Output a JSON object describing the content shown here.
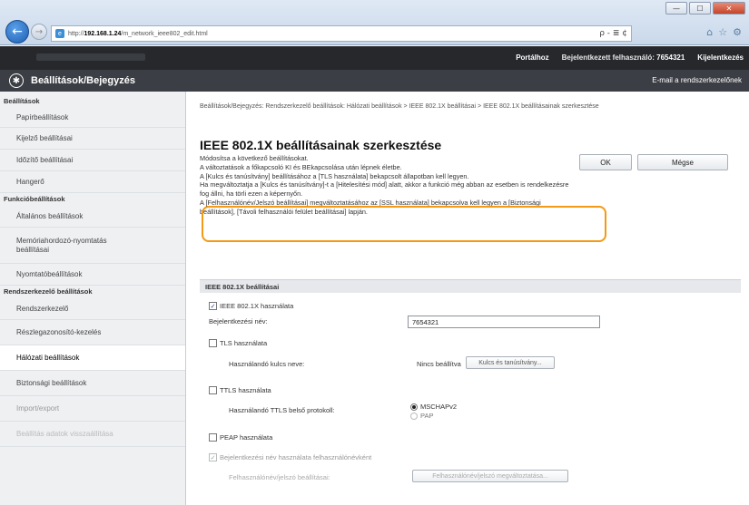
{
  "browser": {
    "url_prefix": "http://",
    "url_host": "192.168.1.24",
    "url_path": "/m_network_ieee802_edit.html",
    "addr_tools": "ρ - ≣ ¢",
    "window_buttons": [
      "—",
      "☐",
      "✕"
    ],
    "toolbar_icons": [
      "⌂",
      "☆",
      "⚙"
    ]
  },
  "topbar": {
    "portal": "Portálhoz",
    "user_label": "Bejelentkezett felhasználó:",
    "user_id": "7654321",
    "logout": "Kijelentkezés"
  },
  "titlebar": {
    "title": "Beállítások/Bejegyzés",
    "email": "E-mail a rendszerkezelőnek"
  },
  "sidebar": {
    "head1": "Beállítások",
    "item_paper": "Papírbeállítások",
    "item_display": "Kijelző beállításai",
    "item_timer": "Időzítő beállításai",
    "item_sound": "Hangerő",
    "head2": "Funkcióbeállítások",
    "item_general": "Általános beállítások",
    "item_memory": "Memóriahordozó-nyomtatás beállításai",
    "item_print": "Nyomtatóbeállítások",
    "head3": "Rendszerkezelő beállítások",
    "item_admin": "Rendszerkezelő",
    "item_dept": "Részlegazonosító-kezelés",
    "item_network": "Hálózati beállítások",
    "item_security": "Biztonsági beállítások",
    "item_importexport": "Import/export",
    "item_init": "Beállítás adatok visszaállítása"
  },
  "main": {
    "breadcrumb": "Beállítások/Bejegyzés: Rendszerkezelő beállítások: Hálózati beállítások > IEEE 802.1X beállításai > IEEE 802.1X beállításainak szerkesztése",
    "title": "IEEE 802.1X beállításainak szerkesztése",
    "desc1": "Módosítsa a következő beállításokat.",
    "desc2": "A változtatások a főkapcsoló KI és BEkapcsolása után lépnek életbe.",
    "desc3": "A [Kulcs és tanúsítvány] beállításához a [TLS használata] bekapcsolt állapotban kell legyen.",
    "desc4": "Ha megváltoztatja a [Kulcs és tanúsítvány]-t a [Hitelesítési mód] alatt, akkor a funkció még abban az esetben is rendelkezésre fog állni, ha törli ezen a képernyőn.",
    "desc5": "A [Felhasználónév/Jelszó beállításai] megváltoztatásához az [SSL használata] bekapcsolva kell legyen a [Biztonsági beállítások], [Távoli felhasználói felület beállításai] lapján.",
    "ok": "OK",
    "cancel": "Mégse",
    "section": "IEEE 802.1X beállításai",
    "use_ieee": "IEEE 802.1X használata",
    "login_name_label": "Bejelentkezési név:",
    "login_name_value": "7654321",
    "use_tls": "TLS használata",
    "key_name_label": "Használandó kulcs neve:",
    "key_name_value": "Nincs beállítva",
    "key_cert_btn": "Kulcs és tanúsítvány...",
    "use_ttls": "TTLS használata",
    "ttls_protocol_label": "Használandó TTLS belső protokoll:",
    "mschap": "MSCHAPv2",
    "pap": "PAP",
    "use_peap": "PEAP használata",
    "use_login_as_user": "Bejelentkezési név használata felhasználónévként",
    "userpass_label": "Felhasználónév/jelszó beállításai:",
    "userpass_btn": "Felhasználónév/jelszó megváltoztatása..."
  }
}
